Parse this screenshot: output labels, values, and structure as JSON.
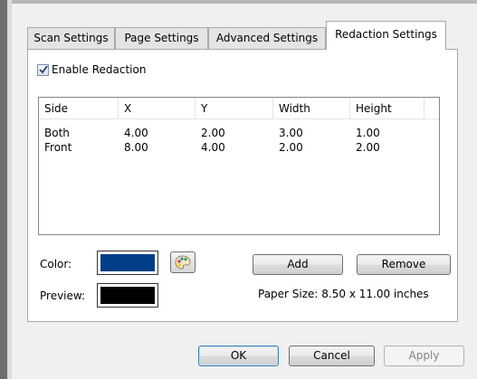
{
  "tabs": [
    {
      "label": "Scan Settings"
    },
    {
      "label": "Page Settings"
    },
    {
      "label": "Advanced Settings"
    },
    {
      "label": "Redaction Settings"
    }
  ],
  "enable_redaction": {
    "label": "Enable Redaction",
    "checked": true
  },
  "table": {
    "columns": [
      "Side",
      "X",
      "Y",
      "Width",
      "Height"
    ],
    "rows": [
      [
        "Both",
        "4.00",
        "2.00",
        "3.00",
        "1.00"
      ],
      [
        "Front",
        "8.00",
        "4.00",
        "2.00",
        "2.00"
      ]
    ]
  },
  "color": {
    "label": "Color:",
    "value": "#003f87"
  },
  "preview": {
    "label": "Preview:",
    "value": "#000000"
  },
  "buttons": {
    "add": "Add",
    "remove": "Remove",
    "ok": "OK",
    "cancel": "Cancel",
    "apply": "Apply"
  },
  "paper_size": "Paper Size:  8.50 x 11.00 inches",
  "icons": {
    "palette": "palette-icon",
    "checkmark": "checkmark-icon"
  }
}
